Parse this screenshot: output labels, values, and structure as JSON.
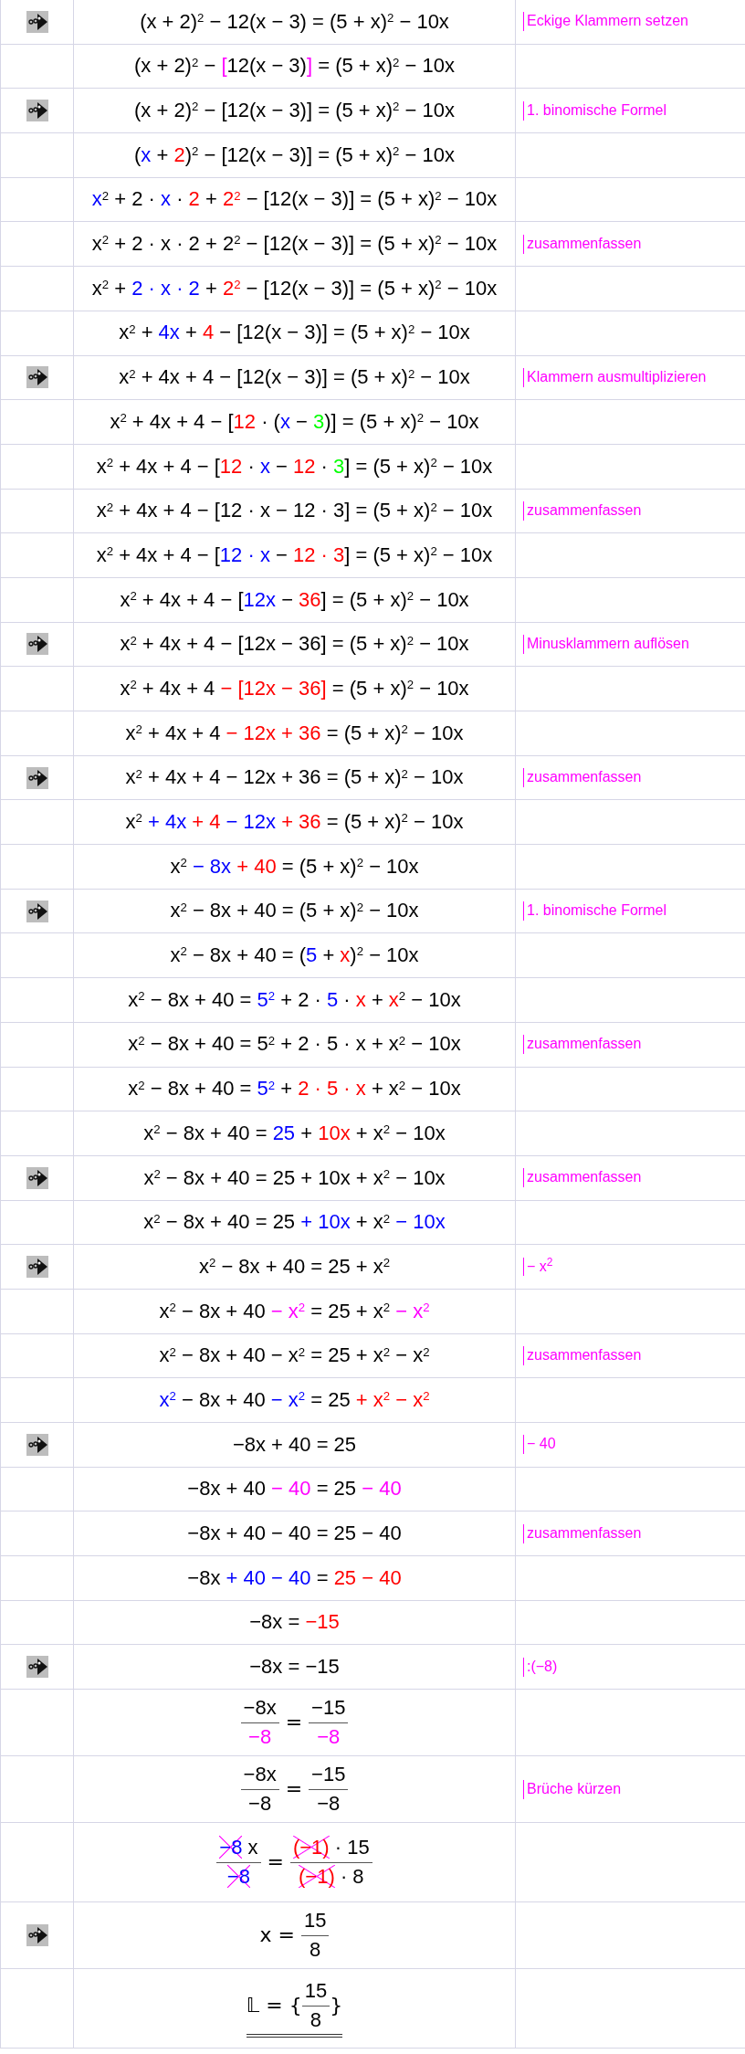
{
  "rows": [
    {
      "kind": "line",
      "marker": true,
      "eq": [
        {
          "text": "(x + 2)$^{2}$ − 12(x − 3) = (5 + x)$^{2}$ − 10x"
        }
      ],
      "note": "Eckige Klammern setzen"
    },
    {
      "kind": "line",
      "marker": false,
      "eq": [
        {
          "text": "(x + 2)$^{2}$ − "
        },
        {
          "text": "[",
          "color": "#ff00ff"
        },
        {
          "text": "12(x − 3)"
        },
        {
          "text": "]",
          "color": "#ff00ff"
        },
        {
          "text": " = (5 + x)$^{2}$ − 10x"
        }
      ]
    },
    {
      "kind": "line",
      "marker": true,
      "eq": [
        {
          "text": "(x + 2)$^{2}$ − [12(x − 3)] = (5 + x)$^{2}$ − 10x"
        }
      ],
      "note": "1. binomische Formel"
    },
    {
      "kind": "line",
      "marker": false,
      "eq": [
        {
          "text": "("
        },
        {
          "text": "x",
          "color": "#0000ff"
        },
        {
          "text": " + "
        },
        {
          "text": "2",
          "color": "#ff0000"
        },
        {
          "text": ")$^{2}$ − [12(x − 3)] = (5 + x)$^{2}$ − 10x"
        }
      ]
    },
    {
      "kind": "line",
      "marker": false,
      "eq": [
        {
          "text": "x",
          "color": "#0000ff"
        },
        {
          "text": "$^{2}$ + 2 · "
        },
        {
          "text": "x",
          "color": "#0000ff"
        },
        {
          "text": " · "
        },
        {
          "text": "2",
          "color": "#ff0000"
        },
        {
          "text": " + "
        },
        {
          "text": "2$^{2}$",
          "color": "#ff0000"
        },
        {
          "text": " − [12(x − 3)] = (5 + x)$^{2}$ − 10x"
        }
      ]
    },
    {
      "kind": "line",
      "marker": false,
      "eq": [
        {
          "text": "x$^{2}$ + 2 · x · 2 + 2$^{2}$ − [12(x − 3)] = (5 + x)$^{2}$ − 10x"
        }
      ],
      "note": "zusammenfassen"
    },
    {
      "kind": "line",
      "marker": false,
      "eq": [
        {
          "text": "x$^{2}$ + "
        },
        {
          "text": "2 · x · 2",
          "color": "#0000ff"
        },
        {
          "text": " + "
        },
        {
          "text": "2$^{2}$",
          "color": "#ff0000"
        },
        {
          "text": " − [12(x − 3)] = (5 + x)$^{2}$ − 10x"
        }
      ]
    },
    {
      "kind": "line",
      "marker": false,
      "eq": [
        {
          "text": "x$^{2}$ + "
        },
        {
          "text": "4x",
          "color": "#0000ff"
        },
        {
          "text": " + "
        },
        {
          "text": "4",
          "color": "#ff0000"
        },
        {
          "text": " − [12(x − 3)] = (5 + x)$^{2}$ − 10x"
        }
      ]
    },
    {
      "kind": "line",
      "marker": true,
      "eq": [
        {
          "text": "x$^{2}$ + 4x + 4 − [12(x − 3)] = (5 + x)$^{2}$ − 10x"
        }
      ],
      "note": "Klammern ausmultiplizieren"
    },
    {
      "kind": "line",
      "marker": false,
      "eq": [
        {
          "text": "x$^{2}$ + 4x + 4 − ["
        },
        {
          "text": "12",
          "color": "#ff0000"
        },
        {
          "text": " · ("
        },
        {
          "text": "x",
          "color": "#0000ff"
        },
        {
          "text": " − "
        },
        {
          "text": "3",
          "color": "#00ff00"
        },
        {
          "text": ")] = (5 + x)$^{2}$ − 10x"
        }
      ]
    },
    {
      "kind": "line",
      "marker": false,
      "eq": [
        {
          "text": "x$^{2}$ + 4x + 4 − ["
        },
        {
          "text": "12",
          "color": "#ff0000"
        },
        {
          "text": " · "
        },
        {
          "text": "x",
          "color": "#0000ff"
        },
        {
          "text": " − "
        },
        {
          "text": "12",
          "color": "#ff0000"
        },
        {
          "text": " · "
        },
        {
          "text": "3",
          "color": "#00ff00"
        },
        {
          "text": "] = (5 + x)$^{2}$ − 10x"
        }
      ]
    },
    {
      "kind": "line",
      "marker": false,
      "eq": [
        {
          "text": "x$^{2}$ + 4x + 4 − [12 · x − 12 · 3] = (5 + x)$^{2}$ − 10x"
        }
      ],
      "note": "zusammenfassen"
    },
    {
      "kind": "line",
      "marker": false,
      "eq": [
        {
          "text": "x$^{2}$ + 4x + 4 − ["
        },
        {
          "text": "12 · x",
          "color": "#0000ff"
        },
        {
          "text": " − "
        },
        {
          "text": "12 · 3",
          "color": "#ff0000"
        },
        {
          "text": "] = (5 + x)$^{2}$ − 10x"
        }
      ]
    },
    {
      "kind": "line",
      "marker": false,
      "eq": [
        {
          "text": "x$^{2}$ + 4x + 4 − ["
        },
        {
          "text": "12x",
          "color": "#0000ff"
        },
        {
          "text": " − "
        },
        {
          "text": "36",
          "color": "#ff0000"
        },
        {
          "text": "] = (5 + x)$^{2}$ − 10x"
        }
      ]
    },
    {
      "kind": "line",
      "marker": true,
      "eq": [
        {
          "text": "x$^{2}$ + 4x + 4 − [12x − 36] = (5 + x)$^{2}$ − 10x"
        }
      ],
      "note": "Minusklammern auflösen"
    },
    {
      "kind": "line",
      "marker": false,
      "eq": [
        {
          "text": "x$^{2}$ + 4x + 4 "
        },
        {
          "text": "− [12x − 36]",
          "color": "#ff0000"
        },
        {
          "text": " = (5 + x)$^{2}$ − 10x"
        }
      ]
    },
    {
      "kind": "line",
      "marker": false,
      "eq": [
        {
          "text": "x$^{2}$ + 4x + 4 "
        },
        {
          "text": "− 12x + 36",
          "color": "#ff0000"
        },
        {
          "text": " = (5 + x)$^{2}$ − 10x"
        }
      ]
    },
    {
      "kind": "line",
      "marker": true,
      "eq": [
        {
          "text": "x$^{2}$ + 4x + 4 − 12x + 36 = (5 + x)$^{2}$ − 10x"
        }
      ],
      "note": "zusammenfassen"
    },
    {
      "kind": "line",
      "marker": false,
      "eq": [
        {
          "text": "x$^{2}$ "
        },
        {
          "text": "+ 4x ",
          "color": "#0000ff"
        },
        {
          "text": "+ 4 ",
          "color": "#ff0000"
        },
        {
          "text": "− 12x ",
          "color": "#0000ff"
        },
        {
          "text": "+ 36",
          "color": "#ff0000"
        },
        {
          "text": " = (5 + x)$^{2}$ − 10x"
        }
      ]
    },
    {
      "kind": "line",
      "marker": false,
      "eq": [
        {
          "text": "x$^{2}$ "
        },
        {
          "text": "− 8x ",
          "color": "#0000ff"
        },
        {
          "text": "+ 40",
          "color": "#ff0000"
        },
        {
          "text": " = (5 + x)$^{2}$ − 10x"
        }
      ]
    },
    {
      "kind": "line",
      "marker": true,
      "eq": [
        {
          "text": "x$^{2}$ − 8x + 40 = (5 + x)$^{2}$ − 10x"
        }
      ],
      "note": "1. binomische Formel"
    },
    {
      "kind": "line",
      "marker": false,
      "eq": [
        {
          "text": "x$^{2}$ − 8x + 40 = ("
        },
        {
          "text": "5",
          "color": "#0000ff"
        },
        {
          "text": " + "
        },
        {
          "text": "x",
          "color": "#ff0000"
        },
        {
          "text": ")$^{2}$ − 10x"
        }
      ]
    },
    {
      "kind": "line",
      "marker": false,
      "eq": [
        {
          "text": "x$^{2}$ − 8x + 40 = "
        },
        {
          "text": "5$^{2}$",
          "color": "#0000ff"
        },
        {
          "text": " + 2 · "
        },
        {
          "text": "5",
          "color": "#0000ff"
        },
        {
          "text": " · "
        },
        {
          "text": "x",
          "color": "#ff0000"
        },
        {
          "text": " + "
        },
        {
          "text": "x",
          "color": "#ff0000"
        },
        {
          "text": "$^{2}$ − 10x"
        }
      ]
    },
    {
      "kind": "line",
      "marker": false,
      "eq": [
        {
          "text": "x$^{2}$ − 8x + 40 = 5$^{2}$ + 2 · 5 · x + x$^{2}$ − 10x"
        }
      ],
      "note": "zusammenfassen"
    },
    {
      "kind": "line",
      "marker": false,
      "eq": [
        {
          "text": "x$^{2}$ − 8x + 40 = "
        },
        {
          "text": "5$^{2}$",
          "color": "#0000ff"
        },
        {
          "text": " + "
        },
        {
          "text": "2 · 5 · x",
          "color": "#ff0000"
        },
        {
          "text": " + x$^{2}$ − 10x"
        }
      ]
    },
    {
      "kind": "line",
      "marker": false,
      "eq": [
        {
          "text": "x$^{2}$ − 8x + 40 = "
        },
        {
          "text": "25",
          "color": "#0000ff"
        },
        {
          "text": " + "
        },
        {
          "text": "10x",
          "color": "#ff0000"
        },
        {
          "text": " + x$^{2}$ − 10x"
        }
      ]
    },
    {
      "kind": "line",
      "marker": true,
      "eq": [
        {
          "text": "x$^{2}$ − 8x + 40 = 25 + 10x + x$^{2}$ − 10x"
        }
      ],
      "note": "zusammenfassen"
    },
    {
      "kind": "line",
      "marker": false,
      "eq": [
        {
          "text": "x$^{2}$ − 8x + 40 = 25 "
        },
        {
          "text": "+ 10x",
          "color": "#0000ff"
        },
        {
          "text": " + x$^{2}$ "
        },
        {
          "text": "− 10x",
          "color": "#0000ff"
        }
      ]
    },
    {
      "kind": "line",
      "marker": true,
      "eq": [
        {
          "text": "x$^{2}$ − 8x + 40 = 25 + x$^{2}$"
        }
      ],
      "note": "− x$^{2}$"
    },
    {
      "kind": "line",
      "marker": false,
      "eq": [
        {
          "text": "x$^{2}$ − 8x + 40 "
        },
        {
          "text": "− x$^{2}$",
          "color": "#ff00ff"
        },
        {
          "text": " = 25 + x$^{2}$ "
        },
        {
          "text": "− x$^{2}$",
          "color": "#ff00ff"
        }
      ]
    },
    {
      "kind": "line",
      "marker": false,
      "eq": [
        {
          "text": "x$^{2}$ − 8x + 40 − x$^{2}$ = 25 + x$^{2}$ − x$^{2}$"
        }
      ],
      "note": "zusammenfassen"
    },
    {
      "kind": "line",
      "marker": false,
      "eq": [
        {
          "text": "x$^{2}$",
          "color": "#0000ff"
        },
        {
          "text": " − 8x + 40 "
        },
        {
          "text": "− x$^{2}$",
          "color": "#0000ff"
        },
        {
          "text": " = 25 "
        },
        {
          "text": "+ x$^{2}$ − x$^{2}$",
          "color": "#ff0000"
        }
      ]
    },
    {
      "kind": "line",
      "marker": true,
      "eq": [
        {
          "text": "−8x + 40 = 25"
        }
      ],
      "note": "− 40"
    },
    {
      "kind": "line",
      "marker": false,
      "eq": [
        {
          "text": "−8x + 40 "
        },
        {
          "text": "− 40",
          "color": "#ff00ff"
        },
        {
          "text": " = 25 "
        },
        {
          "text": "− 40",
          "color": "#ff00ff"
        }
      ]
    },
    {
      "kind": "line",
      "marker": false,
      "eq": [
        {
          "text": "−8x + 40 − 40 = 25 − 40"
        }
      ],
      "note": "zusammenfassen"
    },
    {
      "kind": "line",
      "marker": false,
      "eq": [
        {
          "text": "−8x "
        },
        {
          "text": "+ 40 − 40",
          "color": "#0000ff"
        },
        {
          "text": " = "
        },
        {
          "text": "25 − 40",
          "color": "#ff0000"
        }
      ]
    },
    {
      "kind": "line",
      "marker": false,
      "eq": [
        {
          "text": "−8x = "
        },
        {
          "text": "−15",
          "color": "#ff0000"
        }
      ]
    },
    {
      "kind": "line",
      "marker": true,
      "eq": [
        {
          "text": "−8x = −15"
        }
      ],
      "note": ":(−8)"
    },
    {
      "kind": "fraction",
      "marker": false,
      "parts": [
        {
          "kind": "fraction",
          "num": [
            {
              "text": "−8x"
            }
          ],
          "den": [
            {
              "text": "−8",
              "color": "#ff00ff"
            }
          ]
        },
        {
          "kind": "text",
          "segments": [
            {
              "text": " = "
            }
          ]
        },
        {
          "kind": "fraction",
          "num": [
            {
              "text": "−15"
            }
          ],
          "den": [
            {
              "text": "−8",
              "color": "#ff00ff"
            }
          ]
        }
      ]
    },
    {
      "kind": "fraction",
      "marker": false,
      "parts": [
        {
          "kind": "fraction",
          "num": [
            {
              "text": "−8x"
            }
          ],
          "den": [
            {
              "text": "−8"
            }
          ]
        },
        {
          "kind": "text",
          "segments": [
            {
              "text": " = "
            }
          ]
        },
        {
          "kind": "fraction",
          "num": [
            {
              "text": "−15"
            }
          ],
          "den": [
            {
              "text": "−8"
            }
          ]
        }
      ],
      "note": "Brüche kürzen"
    },
    {
      "kind": "fraction",
      "marker": false,
      "parts": [
        {
          "kind": "fraction",
          "num": [
            {
              "text": "−8",
              "color": "#0000ff",
              "struck": true
            },
            {
              "text": " x"
            }
          ],
          "den": [
            {
              "text": "−8",
              "color": "#0000ff",
              "struck": true
            }
          ]
        },
        {
          "kind": "text",
          "segments": [
            {
              "text": " = "
            }
          ]
        },
        {
          "kind": "fraction",
          "num": [
            {
              "text": "(−1)",
              "color": "#ff0000",
              "struck": true
            },
            {
              "text": " · 15"
            }
          ],
          "den": [
            {
              "text": "(−1)",
              "color": "#ff0000",
              "struck": true
            },
            {
              "text": " · 8"
            }
          ]
        }
      ]
    },
    {
      "kind": "fraction",
      "marker": true,
      "parts": [
        {
          "kind": "text",
          "segments": [
            {
              "text": "x = "
            }
          ]
        },
        {
          "kind": "fraction",
          "num": [
            {
              "text": "15"
            }
          ],
          "den": [
            {
              "text": "8"
            }
          ]
        }
      ]
    },
    {
      "kind": "fraction",
      "marker": false,
      "double_underline": true,
      "parts": [
        {
          "kind": "text",
          "segments": [
            {
              "text": "𝕃 = {"
            }
          ]
        },
        {
          "kind": "fraction",
          "num": [
            {
              "text": "15"
            }
          ],
          "den": [
            {
              "text": "8"
            }
          ]
        },
        {
          "kind": "text",
          "segments": [
            {
              "text": "}"
            }
          ]
        }
      ]
    }
  ]
}
